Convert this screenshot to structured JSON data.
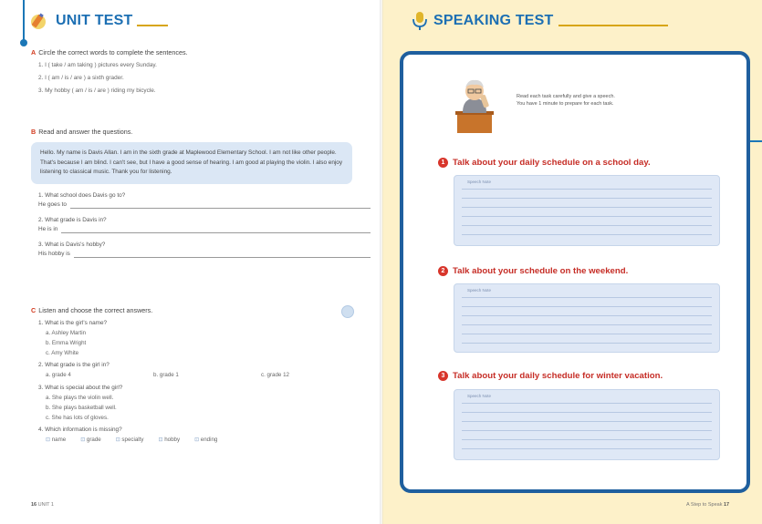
{
  "left_page": {
    "header": {
      "title": "UNIT TEST"
    },
    "section_a": {
      "letter": "A",
      "instruction": "Circle the correct words to complete the sentences.",
      "items": [
        "1. I ( take / am taking ) pictures every Sunday.",
        "2. I ( am / is / are ) a sixth grader.",
        "3. My hobby ( am / is / are ) riding my bicycle."
      ]
    },
    "section_b": {
      "letter": "B",
      "instruction": "Read and answer the questions.",
      "passage": "Hello. My name is Davis Allan. I am in the sixth grade at Maplewood Elementary School. I am not like other people. That's because I am blind. I can't see, but I have a good sense of hearing. I am good at playing the violin. I also enjoy listening to classical music. Thank you for listening.",
      "questions": [
        {
          "q": "1. What school does Davis go to?",
          "a": "He goes to"
        },
        {
          "q": "2. What grade is Davis in?",
          "a": "He is in"
        },
        {
          "q": "3. What is Davis's hobby?",
          "a": "His hobby is"
        }
      ]
    },
    "section_c": {
      "letter": "C",
      "instruction": "Listen and choose the correct answers.",
      "q1": {
        "q": "1. What is the girl's name?",
        "options": [
          "a. Ashley Martin",
          "b. Emma Wright",
          "c. Amy White"
        ]
      },
      "q2": {
        "q": "2. What grade is the girl in?",
        "options": [
          "a. grade 4",
          "b. grade 1",
          "c. grade 12"
        ]
      },
      "q3": {
        "q": "3. What is special about the girl?",
        "options": [
          "a. She plays the violin well.",
          "b. She plays basketball well.",
          "c. She has lots of gloves."
        ]
      },
      "q4": {
        "q": "4. Which information is missing?",
        "options": [
          "name",
          "grade",
          "specialty",
          "hobby",
          "ending"
        ]
      }
    },
    "footer": {
      "page": "16",
      "label": "UNIT 1"
    }
  },
  "right_page": {
    "header": {
      "title": "SPEAKING TEST"
    },
    "instruction_line1": "Read each task carefully and give a speech.",
    "instruction_line2": "You have 1 minute to prepare for each task.",
    "tasks": [
      {
        "num": "1",
        "text": "Talk about your daily schedule on a school day.",
        "notes_label": "Speech Note"
      },
      {
        "num": "2",
        "text": "Talk about your schedule on the weekend.",
        "notes_label": "Speech Note"
      },
      {
        "num": "3",
        "text": "Talk about your daily schedule for winter vacation.",
        "notes_label": "Speech Note"
      }
    ],
    "footer": {
      "label": "A Step to Speak",
      "page": "17"
    }
  },
  "colors": {
    "blue": "#1c6fb3",
    "red": "#c62d26",
    "gold": "#d7a515",
    "cream": "#fdf1c9",
    "note_blue": "#dfe8f6"
  },
  "icons": [
    "pencil-icon",
    "mic-icon",
    "teacher-icon",
    "listen-icon"
  ]
}
